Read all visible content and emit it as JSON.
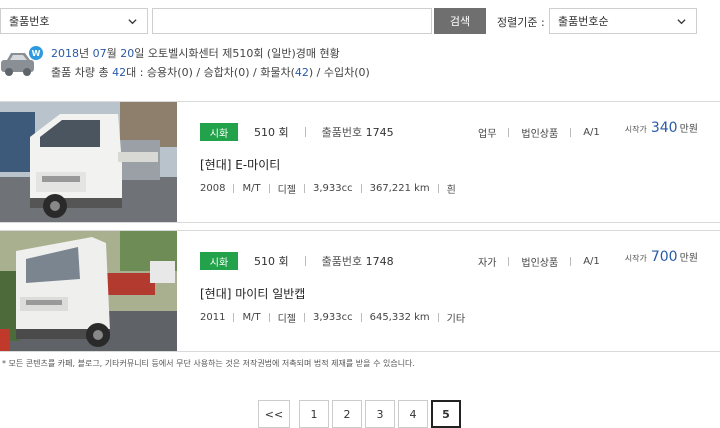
{
  "search": {
    "field_select": "출품번호",
    "input_value": "",
    "button_label": "검색",
    "sort_label": "정렬기준 :",
    "sort_select": "출품번호순"
  },
  "info": {
    "badge": "W",
    "year": "2018",
    "year_suffix": "년",
    "month": "07",
    "month_suffix": "월",
    "day": "20",
    "day_suffix": "일 오토벨시화센터 제510회 (일반)경매 현황",
    "total_prefix": "출품 차량 총",
    "total_count": "42",
    "total_suffix": "대 : 승용차(",
    "passenger": "0",
    "van_prefix": ") / 승합차(",
    "van": "0",
    "truck_prefix": ") / 화물차(",
    "truck": "42",
    "import_prefix": ") / 수입차(",
    "import": "0",
    "end": ")"
  },
  "listings": [
    {
      "tag": "시화",
      "round": "510 회",
      "lot_label": "출품번호",
      "lot_no": "1745",
      "usage": "업무",
      "seller": "법인상품",
      "grade": "A/1",
      "price_label": "시작가",
      "price": "340",
      "price_unit": "만원",
      "title": "[현대] E-마이티",
      "year": "2008",
      "transmission": "M/T",
      "fuel": "디젤",
      "displacement": "3,933cc",
      "mileage": "367,221 km",
      "color": "흰"
    },
    {
      "tag": "시화",
      "round": "510 회",
      "lot_label": "출품번호",
      "lot_no": "1748",
      "usage": "자가",
      "seller": "법인상품",
      "grade": "A/1",
      "price_label": "시작가",
      "price": "700",
      "price_unit": "만원",
      "title": "[현대] 마이티 일반캡",
      "year": "2011",
      "transmission": "M/T",
      "fuel": "디젤",
      "displacement": "3,933cc",
      "mileage": "645,332 km",
      "color": "기타"
    }
  ],
  "copyright": "* 모든 콘텐츠를 카페, 블로그, 기타커뮤니티 등에서 무단 사용하는 것은 저작권법에 저촉되며 법적 제재를 받을 수 있습니다.",
  "pagination": {
    "prev": "<<",
    "pages": [
      "1",
      "2",
      "3",
      "4",
      "5"
    ],
    "current": "5"
  },
  "colors": {
    "tag_green": "#22a34b",
    "price_blue": "#2a5aa8",
    "search_button": "#6f6f6f",
    "badge_blue": "#2d9ae0"
  },
  "icons": [
    "chevron-down-icon",
    "truck-icon"
  ]
}
